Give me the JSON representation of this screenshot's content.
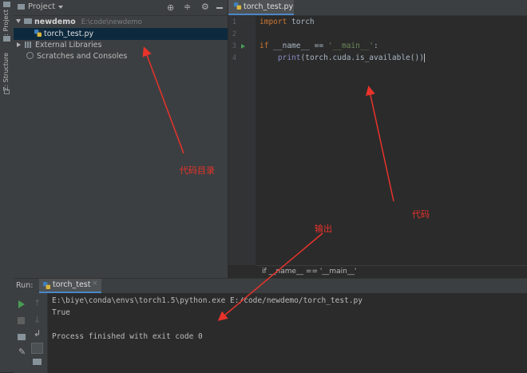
{
  "left_strip": {
    "project_label": "1: Project",
    "structure_label": "Z: Structure"
  },
  "project_panel": {
    "title": "Project",
    "tree": [
      {
        "label": "newdemo",
        "path": "E:\\code\\newdemo"
      },
      {
        "label": "torch_test.py"
      },
      {
        "label": "External Libraries"
      },
      {
        "label": "Scratches and Consoles"
      }
    ]
  },
  "editor": {
    "tab_label": "torch_test.py",
    "line_numbers": [
      "1",
      "2",
      "3",
      "4"
    ],
    "code": {
      "line1_kw": "import",
      "line1_rest": " torch",
      "line3_kw": "if",
      "line3_mid": " __name__ == ",
      "line3_str": "'__main__'",
      "line3_end": ":",
      "line4_indent": "    ",
      "line4_fn": "print",
      "line4_rest": "(torch.cuda.is_available())"
    },
    "breadcrumb": "if __name__ == '__main__'"
  },
  "run_panel": {
    "label": "Run:",
    "tab_label": "torch_test",
    "console_lines": [
      "E:\\biye\\conda\\envs\\torch1.5\\python.exe E:/code/newdemo/torch_test.py",
      "True",
      "",
      "Process finished with exit code 0"
    ]
  },
  "annotations": {
    "code_dir": "代码目录",
    "code": "代码",
    "output": "输出"
  },
  "colors": {
    "annotation": "#e8332b",
    "keyword": "#cc7832",
    "string": "#6a8759",
    "builtin": "#8888c6",
    "selection": "#0d293e",
    "accent": "#4a88c7"
  }
}
